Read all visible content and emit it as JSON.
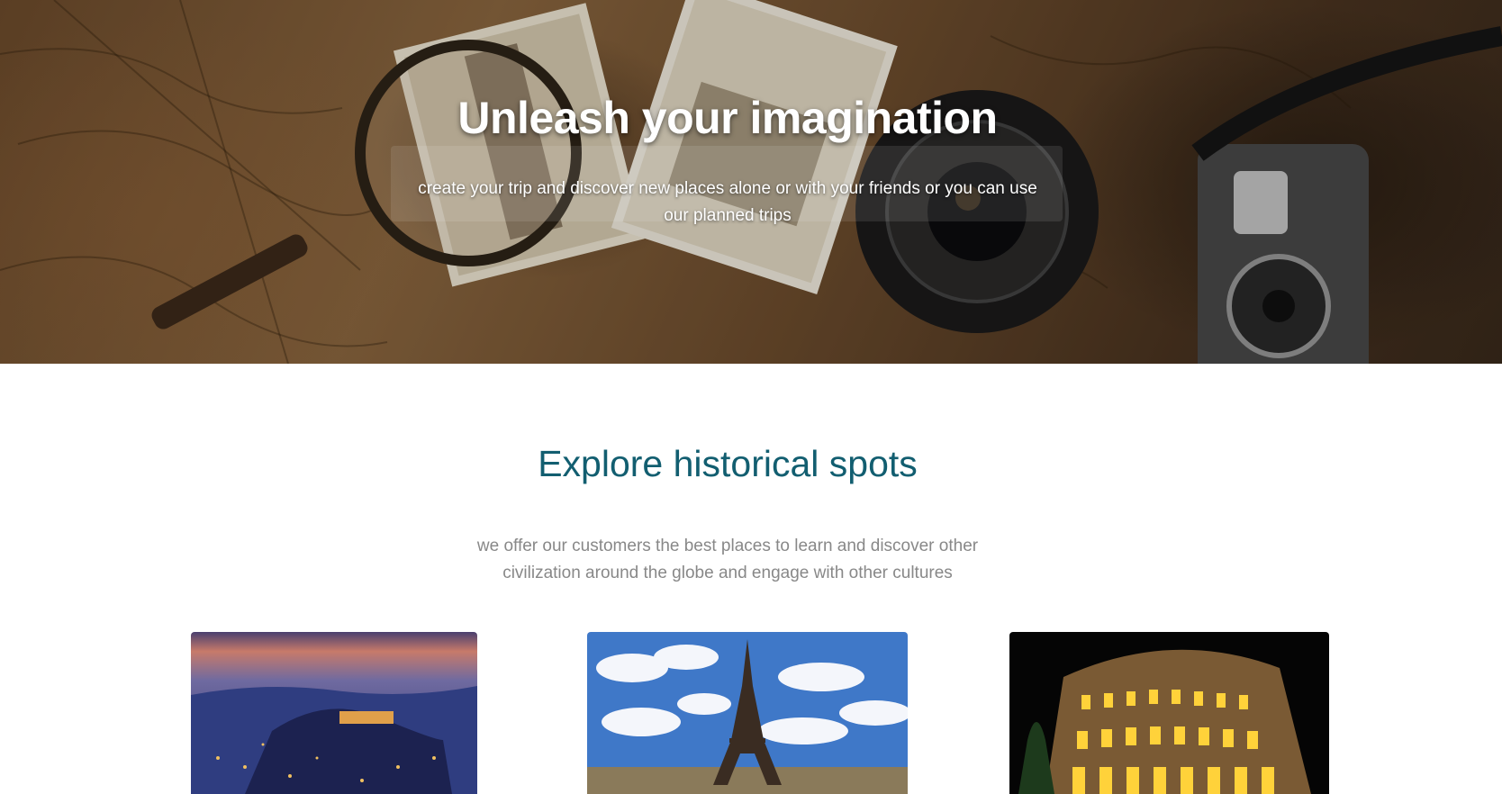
{
  "hero": {
    "title": "Unleash your imagination",
    "subtitle": "create your  trip and discover new places alone or with your friends or you can use our planned trips",
    "background_image": "vintage map with magnifying glass, postcards and camera"
  },
  "section": {
    "title": "Explore historical spots",
    "description": "we offer our customers the best places to learn and discover other civilization around the globe and engage with other cultures"
  },
  "destinations": [
    {
      "image": "acropolis-at-dusk-photo"
    },
    {
      "image": "eiffel-tower-photo"
    },
    {
      "image": "colosseum-at-night-photo"
    }
  ],
  "colors": {
    "section_title": "#125e70",
    "description_text": "#888888",
    "hero_text": "#ffffff"
  }
}
